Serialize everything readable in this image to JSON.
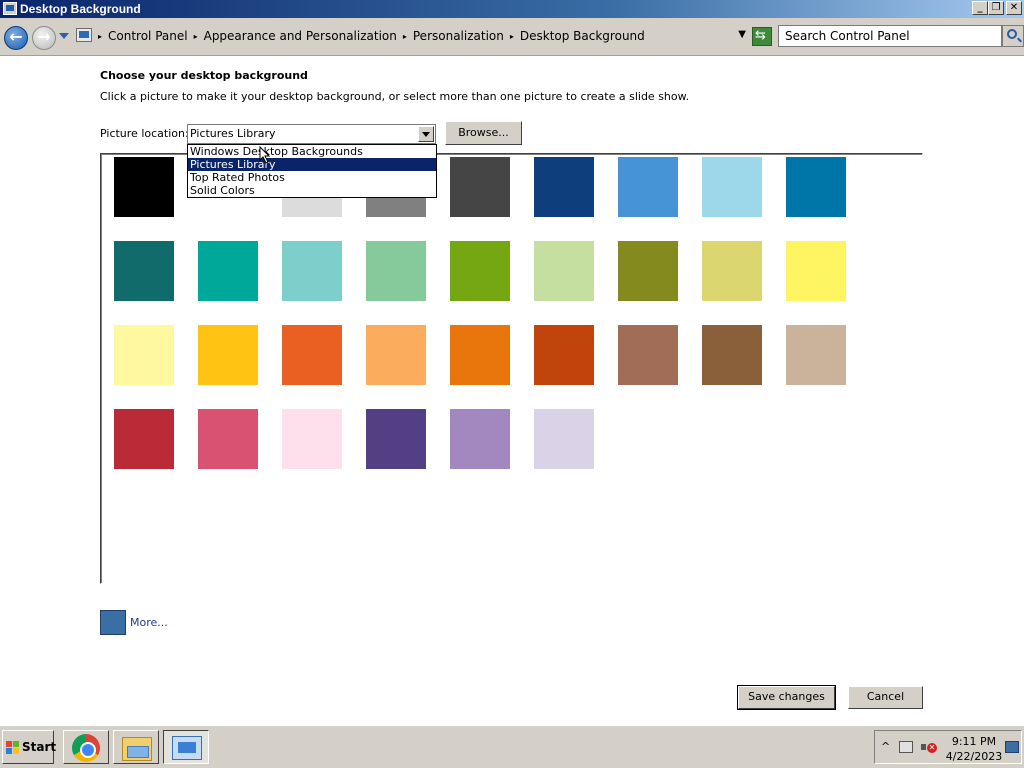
{
  "window": {
    "title": "Desktop Background",
    "minimize": "_",
    "restore": "❐",
    "close": "✕"
  },
  "address": {
    "breadcrumbs": [
      "Control Panel",
      "Appearance and Personalization",
      "Personalization",
      "Desktop Background"
    ],
    "search_placeholder": "Search Control Panel"
  },
  "content": {
    "heading": "Choose your desktop background",
    "subtext": "Click a picture to make it your desktop background, or select more than one picture to create a slide show.",
    "location_label": "Picture location:",
    "location_value": "Pictures Library",
    "browse_label": "Browse...",
    "location_options": [
      "Windows Desktop Backgrounds",
      "Pictures Library",
      "Top Rated Photos",
      "Solid Colors"
    ],
    "selected_option_index": 1,
    "swatches": [
      "#000000",
      "#ffffff",
      "#dcdcdc",
      "#808080",
      "#454545",
      "#0e3f7c",
      "#4694d6",
      "#9dd8ea",
      "#0076a8",
      "#126b6b",
      "#00a89a",
      "#7ccfcb",
      "#86c99b",
      "#74a813",
      "#c4dfa0",
      "#858a1e",
      "#dcd670",
      "#fef562",
      "#fef8a0",
      "#ffc314",
      "#ea5f22",
      "#fbac5c",
      "#e8760c",
      "#c1450a",
      "#a26d56",
      "#8a603a",
      "#cab29b",
      "#bb2a37",
      "#d95272",
      "#fde0ec",
      "#533f83",
      "#a288bf",
      "#dad2e6"
    ],
    "more_label": "More...",
    "more_color": "#3a6ea5",
    "save_label": "Save changes",
    "cancel_label": "Cancel"
  },
  "taskbar": {
    "start_label": "Start",
    "time": "9:11 PM",
    "date": "4/22/2023",
    "tray_chevron": "^"
  }
}
